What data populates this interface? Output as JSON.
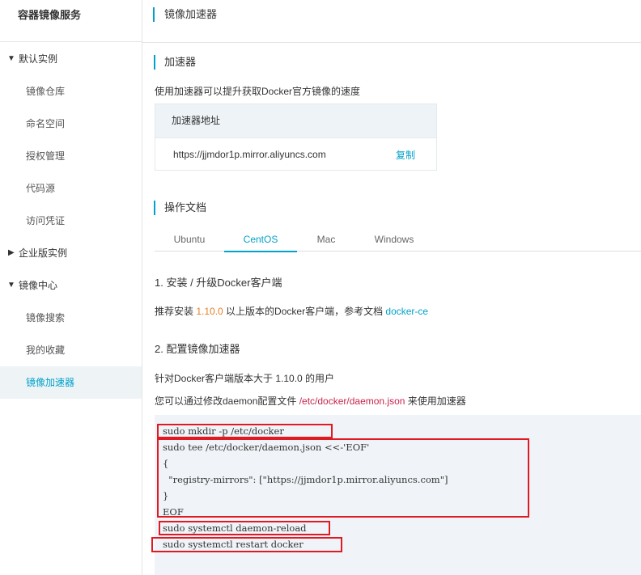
{
  "sidebar": {
    "title": "容器镜像服务",
    "groups": [
      {
        "label": "默认实例",
        "expanded": true,
        "items": [
          "镜像仓库",
          "命名空间",
          "授权管理",
          "代码源",
          "访问凭证"
        ]
      },
      {
        "label": "企业版实例",
        "expanded": false,
        "items": []
      },
      {
        "label": "镜像中心",
        "expanded": true,
        "items": [
          "镜像搜索",
          "我的收藏",
          "镜像加速器"
        ]
      }
    ],
    "active_item": "镜像加速器"
  },
  "header": {
    "title": "镜像加速器"
  },
  "accelerator": {
    "section_title": "加速器",
    "description": "使用加速器可以提升获取Docker官方镜像的速度",
    "table_header": "加速器地址",
    "url": "https://jjmdor1p.mirror.aliyuncs.com",
    "copy_label": "复制"
  },
  "docs": {
    "section_title": "操作文档",
    "tabs": [
      "Ubuntu",
      "CentOS",
      "Mac",
      "Windows"
    ],
    "active_tab": "CentOS",
    "step1": {
      "title": "1. 安装 / 升级Docker客户端",
      "text_before": "推荐安装 ",
      "version": "1.10.0",
      "text_after": " 以上版本的Docker客户端，参考文档 ",
      "link": "docker-ce"
    },
    "step2": {
      "title": "2. 配置镜像加速器",
      "line1": "针对Docker客户端版本大于 1.10.0 的用户",
      "line2_before": "您可以通过修改daemon配置文件 ",
      "line2_path": "/etc/docker/daemon.json",
      "line2_after": " 来使用加速器"
    },
    "code_lines": [
      "sudo mkdir -p /etc/docker",
      "sudo tee /etc/docker/daemon.json <<-'EOF'",
      "{",
      "  \"registry-mirrors\": [\"https://jjmdor1p.mirror.aliyuncs.com\"]",
      "}",
      "EOF",
      "sudo systemctl daemon-reload",
      "sudo systemctl restart docker"
    ],
    "highlight_color": "#e01a22"
  },
  "colors": {
    "accent": "#00a2ca",
    "version": "#e67e22",
    "path": "#c7254e"
  }
}
